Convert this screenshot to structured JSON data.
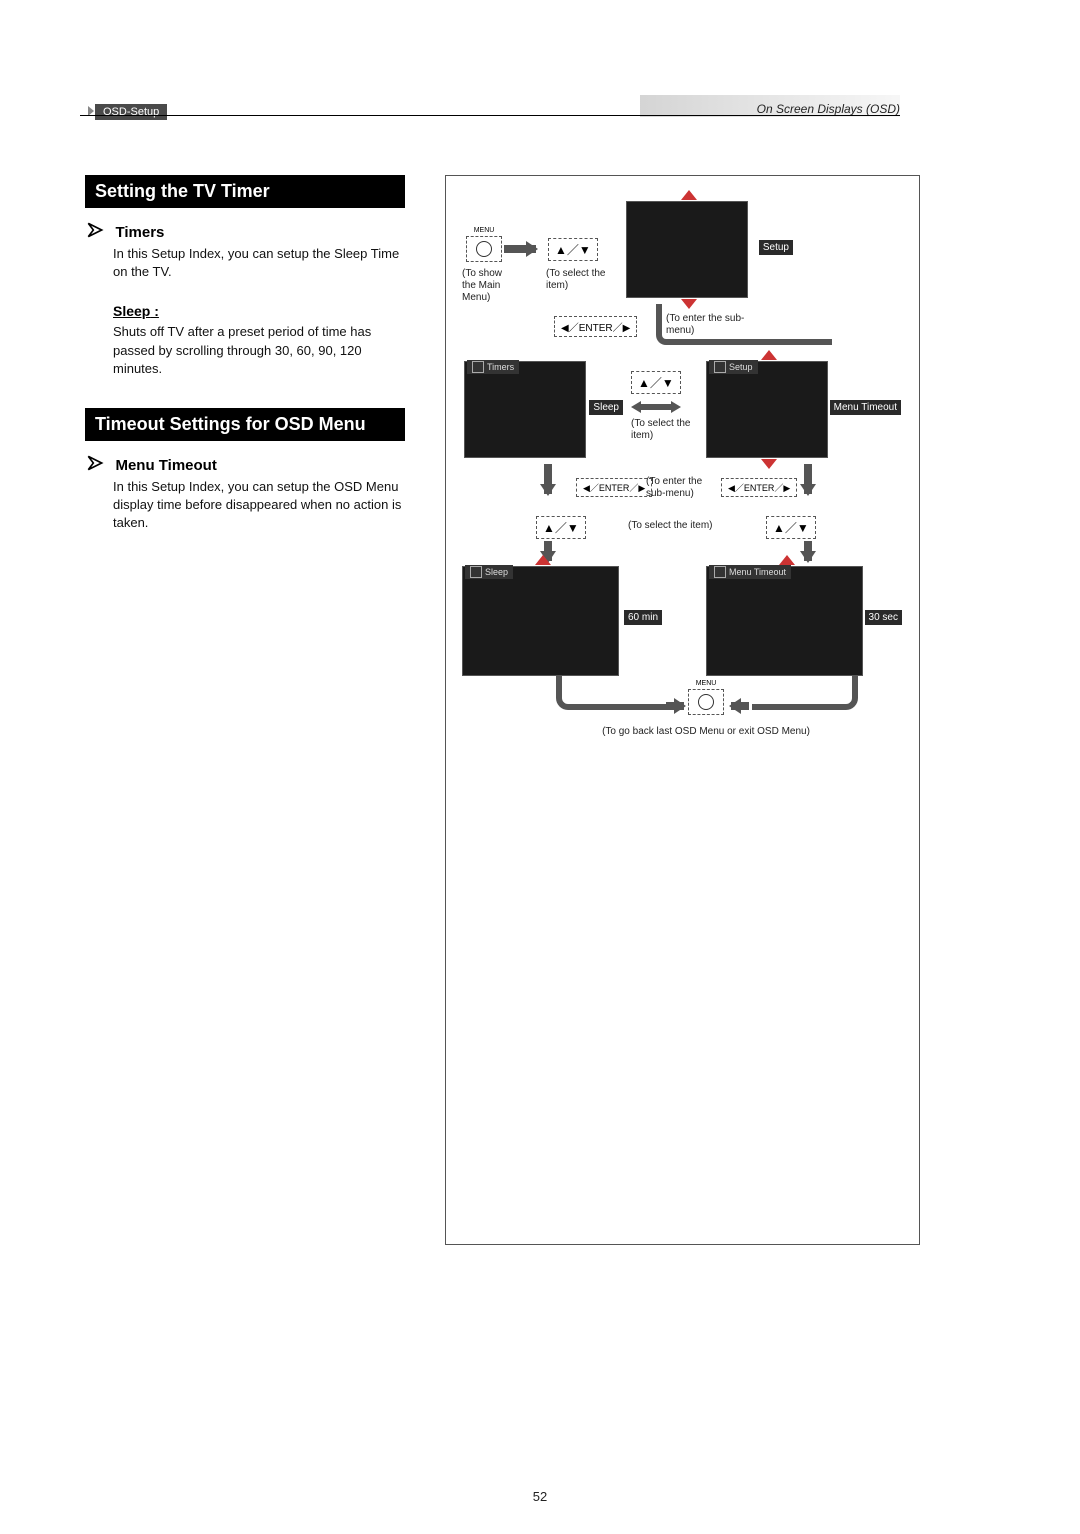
{
  "header": {
    "left_badge": "OSD-Setup",
    "right": "On Screen Displays (OSD)"
  },
  "page_number": "52",
  "sections": [
    {
      "title": "Setting the TV Timer",
      "items": [
        {
          "heading": "Timers",
          "body": "In this Setup Index, you can setup the Sleep Time on the TV.",
          "sub": {
            "label": "Sleep",
            "punct": " :",
            "body": "Shuts off TV after a preset period of time has passed by scrolling through 30, 60, 90, 120 minutes."
          }
        }
      ]
    },
    {
      "title": "Timeout Settings for OSD Menu",
      "items": [
        {
          "heading": "Menu Timeout",
          "body": "In this Setup Index, you can setup the OSD Menu display time before disappeared when no action is taken."
        }
      ]
    }
  ],
  "diagram": {
    "captions": {
      "show_main": "(To show the Main Menu)",
      "select_item": "(To select the item)",
      "enter_sub": "(To enter the sub-menu)",
      "select_item2": "(To select the item)",
      "enter_sub2": "(To enter the sub-menu)",
      "select_item3": "(To select the item)",
      "go_back": "(To go back last OSD Menu or exit OSD Menu)"
    },
    "keys": {
      "updown": "▲／▼",
      "leftright": "◀／ENTER／▶",
      "menu_label": "MENU"
    },
    "thumbs": {
      "setup": "Setup",
      "timers": "Timers",
      "sleep": "Sleep",
      "menu_timeout": "Menu Timeout",
      "sleep_big": "Sleep",
      "sleep_val": "60 min",
      "mt_big": "Menu Timeout",
      "mt_val": "30 sec"
    }
  }
}
